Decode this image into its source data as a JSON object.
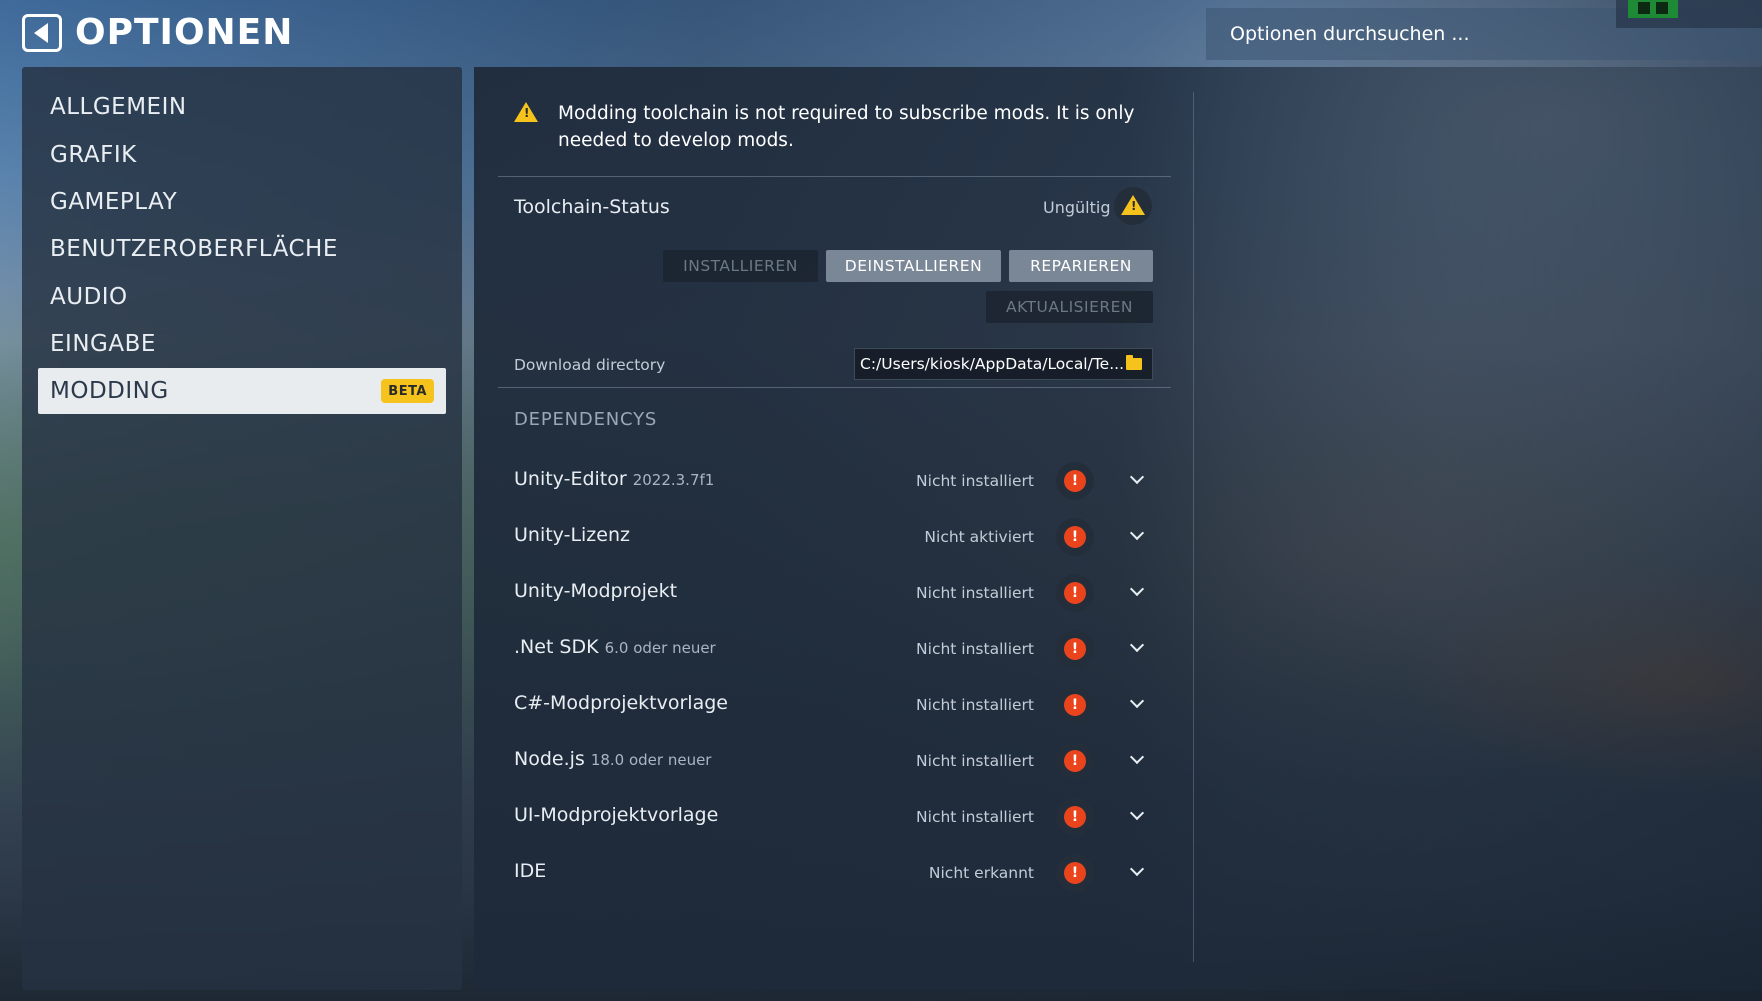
{
  "header": {
    "title": "OPTIONEN",
    "search_placeholder": "Optionen durchsuchen ..."
  },
  "sidebar": {
    "items": [
      {
        "label": "ALLGEMEIN"
      },
      {
        "label": "GRAFIK"
      },
      {
        "label": "GAMEPLAY"
      },
      {
        "label": "BENUTZEROBERFLÄCHE"
      },
      {
        "label": "AUDIO"
      },
      {
        "label": "EINGABE"
      },
      {
        "label": "MODDING",
        "badge": "BETA",
        "active": true
      }
    ]
  },
  "main": {
    "notice": "Modding toolchain is not required to subscribe mods. It is only needed to develop mods.",
    "toolchain": {
      "label": "Toolchain-Status",
      "status": "Ungültig",
      "buttons": {
        "install": "INSTALLIEREN",
        "uninstall": "DEINSTALLIEREN",
        "repair": "REPARIEREN",
        "update": "AKTUALISIEREN"
      }
    },
    "download": {
      "label": "Download directory",
      "value": "C:/Users/kiosk/AppData/Local/Te..."
    },
    "dependencies_title": "DEPENDENCYS",
    "dependencies": [
      {
        "name": "Unity-Editor",
        "version": "2022.3.7f1",
        "status": "Nicht installiert"
      },
      {
        "name": "Unity-Lizenz",
        "version": "",
        "status": "Nicht aktiviert"
      },
      {
        "name": "Unity-Modprojekt",
        "version": "",
        "status": "Nicht installiert"
      },
      {
        "name": ".Net SDK",
        "version": "6.0 oder neuer",
        "status": "Nicht installiert"
      },
      {
        "name": "C#-Modprojektvorlage",
        "version": "",
        "status": "Nicht installiert"
      },
      {
        "name": "Node.js",
        "version": "18.0 oder neuer",
        "status": "Nicht installiert"
      },
      {
        "name": "UI-Modprojektvorlage",
        "version": "",
        "status": "Nicht installiert"
      },
      {
        "name": "IDE",
        "version": "",
        "status": "Nicht erkannt"
      }
    ]
  },
  "colors": {
    "accent_warning": "#f6c21c",
    "error": "#e9441c",
    "panel": "#263242"
  }
}
